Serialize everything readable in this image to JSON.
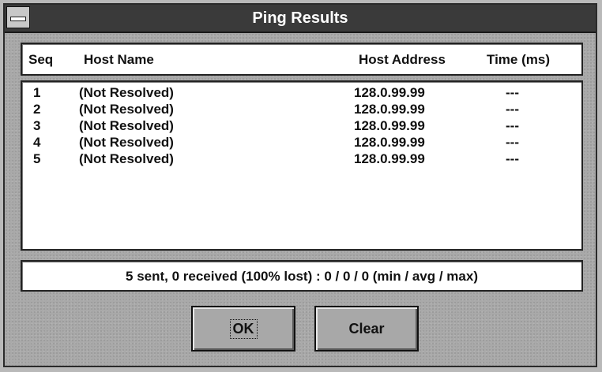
{
  "window": {
    "title": "Ping Results"
  },
  "columns": {
    "seq": "Seq",
    "host_name": "Host Name",
    "host_address": "Host Address",
    "time": "Time (ms)"
  },
  "results": [
    {
      "seq": "1",
      "host_name": "(Not Resolved)",
      "host_address": "128.0.99.99",
      "time": "---"
    },
    {
      "seq": "2",
      "host_name": "(Not Resolved)",
      "host_address": "128.0.99.99",
      "time": "---"
    },
    {
      "seq": "3",
      "host_name": "(Not Resolved)",
      "host_address": "128.0.99.99",
      "time": "---"
    },
    {
      "seq": "4",
      "host_name": "(Not Resolved)",
      "host_address": "128.0.99.99",
      "time": "---"
    },
    {
      "seq": "5",
      "host_name": "(Not Resolved)",
      "host_address": "128.0.99.99",
      "time": "---"
    }
  ],
  "summary": {
    "text": "5 sent, 0 received (100% lost)  :  0 / 0 / 0 (min / avg / max)"
  },
  "buttons": {
    "ok": "OK",
    "clear": "Clear"
  }
}
